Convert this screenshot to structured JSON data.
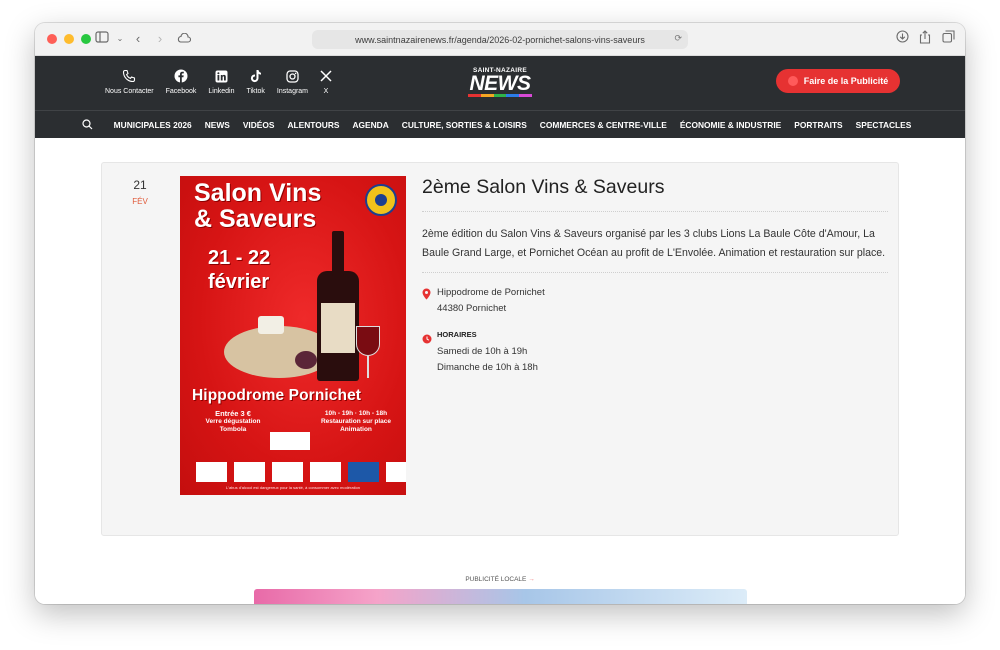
{
  "browser": {
    "url": "www.saintnazairenews.fr/agenda/2026-02-pornichet-salons-vins-saveurs"
  },
  "header": {
    "social": [
      {
        "label": "Nous Contacter",
        "icon": "phone-icon"
      },
      {
        "label": "Facebook",
        "icon": "facebook-icon"
      },
      {
        "label": "Linkedin",
        "icon": "linkedin-icon"
      },
      {
        "label": "Tiktok",
        "icon": "tiktok-icon"
      },
      {
        "label": "Instagram",
        "icon": "instagram-icon"
      },
      {
        "label": "X",
        "icon": "x-icon"
      }
    ],
    "logo_top": "SAINT-NAZAIRE",
    "logo_main": "NEWS",
    "pub_button": "Faire de la Publicité"
  },
  "nav": {
    "items": [
      "MUNICIPALES 2026",
      "NEWS",
      "VIDÉOS",
      "ALENTOURS",
      "AGENDA",
      "CULTURE, SORTIES & LOISIRS",
      "COMMERCES & CENTRE-VILLE",
      "ÉCONOMIE & INDUSTRIE",
      "PORTRAITS",
      "SPECTACLES"
    ]
  },
  "event": {
    "day": "21",
    "month": "FÉV",
    "title": "2ème Salon Vins & Saveurs",
    "description": "2ème édition du Salon Vins & Saveurs organisé par les 3 clubs Lions La Baule Côte d'Amour, La Baule Grand Large, et Pornichet Océan au profit de L'Envolée. Animation et restauration sur place.",
    "location_line1": "Hippodrome de Pornichet",
    "location_line2": "44380 Pornichet",
    "horaires_label": "HORAIRES",
    "horaires_line1": "Samedi de 10h à 19h",
    "horaires_line2": "Dimanche de 10h à 18h"
  },
  "poster": {
    "title_line1": "Salon Vins",
    "title_line2": "& Saveurs",
    "dates_line1": "21 - 22",
    "dates_line2": "février",
    "venue": "Hippodrome Pornichet",
    "info_left_1": "Entrée 3 €",
    "info_left_2": "Verre dégustation",
    "info_left_3": "Tombola",
    "info_right_1": "10h - 19h · 10h - 18h",
    "info_right_2": "Restauration sur place",
    "info_right_3": "Animation",
    "lions_label": "LIONS",
    "envolee_label": "L'ENVOLÉE",
    "footer": "L'abus d'alcool est dangereux pour la santé, à consommer avec modération"
  },
  "footer": {
    "pub_locale": "PUBLICITÉ LOCALE"
  },
  "colors": {
    "accent": "#e63232",
    "topbar": "#2b2e31",
    "logo_bars": [
      "#e63232",
      "#f5a623",
      "#2fb34a",
      "#2b7de9",
      "#d84ad6"
    ]
  }
}
